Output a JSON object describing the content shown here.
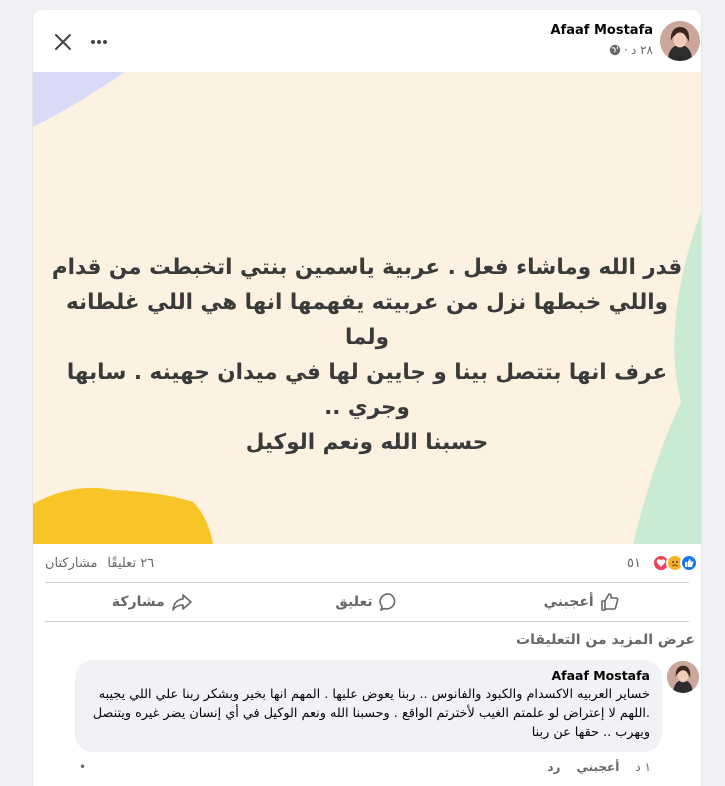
{
  "post": {
    "author": "Afaaf Mostafa",
    "time": "٢٨ د",
    "separator": "·",
    "text_lines": [
      "قدر الله وماشاء فعل . عربية ياسمين بنتي اتخبطت من قدام",
      "واللي خبطها نزل من عربيته يفهمها انها هي اللي غلطانه ولما",
      "عرف انها بتتصل بينا و جايين لها في ميدان جهينه . سابها وجري ..",
      "حسبنا الله ونعم الوكيل"
    ],
    "image_bg": "#fdf1e1"
  },
  "stats": {
    "reactions_count": "٥١",
    "comments": "٢٦ تعليقًا",
    "shares": "مشاركتان"
  },
  "actions": {
    "like": "أعجبني",
    "comment": "تعليق",
    "share": "مشاركة"
  },
  "more_comments": "عرض المزيد من التعليقات",
  "comment": {
    "author": "Afaaf Mostafa",
    "text": "خساير العربيه الاكسدام والكبود والفانوس .. ربنا يعوض عليها . المهم انها بخير وبشكر ربنا علي اللي يجيبه .اللهم لا إعتراض لو علمتم الغيب لأخترتم الواقع . وحسبنا الله ونعم الوكيل في أي إنسان يضر غيره ويتنصل ويهرب .. حقها عن ربنا",
    "time": "١ د",
    "like": "أعجبني",
    "reply": "رد",
    "dot": "•"
  },
  "icons": {
    "close": "close-icon",
    "more": "more-icon",
    "globe": "globe-icon",
    "like": "thumbs-up-icon",
    "comment": "comment-bubble-icon",
    "share": "share-arrow-icon"
  },
  "colors": {
    "like_blue": "#1877f2",
    "love_red": "#f33e58",
    "sad_yellow": "#f7b125",
    "secondary_text": "#65676b"
  }
}
